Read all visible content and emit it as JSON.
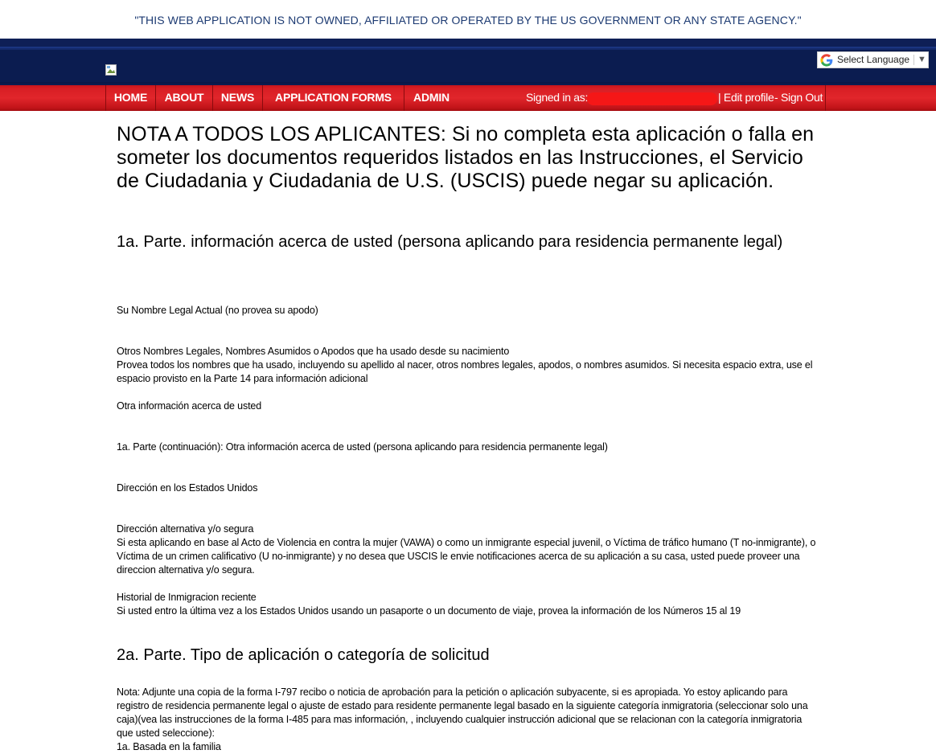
{
  "disclaimer": "\"THIS WEB APPLICATION IS NOT OWNED, AFFILIATED OR OPERATED BY THE US GOVERNMENT OR ANY STATE AGENCY.\"",
  "translate": {
    "label": "Select Language",
    "arrow": "▼",
    "icon": "google-g-icon"
  },
  "nav": {
    "items": [
      {
        "label": "HOME"
      },
      {
        "label": "ABOUT"
      },
      {
        "label": "NEWS"
      },
      {
        "label": "APPLICATION FORMS"
      },
      {
        "label": "ADMIN"
      }
    ],
    "signed_in_label": "Signed in as:",
    "edit_profile": "| Edit profile",
    "separator": "-",
    "sign_out": "Sign Out"
  },
  "colors": {
    "header_blue": "#0e1f56",
    "nav_red": "#d81e24",
    "disclaimer_text": "#1c3a72"
  },
  "main": {
    "notice": "NOTA A TODOS LOS APLICANTES: Si no completa esta aplicación o falla en someter los documentos requeridos listados en las Instrucciones, el Servicio de Ciudadania y Ciudadania de U.S. (USCIS) puede negar su aplicación.",
    "part1_title": "1a. Parte. información acerca de usted (persona aplicando para residencia permanente legal)",
    "legal_name": "Su Nombre Legal Actual (no provea su apodo)",
    "other_names_title": "Otros Nombres Legales, Nombres Asumidos o Apodos que ha usado desde su nacimiento",
    "other_names_desc": "Provea todos los nombres que ha usado, incluyendo su apellido al nacer, otros nombres legales, apodos, o nombres asumidos. Si necesita espacio extra, use el espacio provisto en la Parte 14 para información adicional",
    "other_info": "Otra información acerca de usted",
    "part1_cont": "1a. Parte (continuación): Otra información acerca de usted (persona aplicando para residencia permanente legal)",
    "us_address": "Dirección en los Estados Unidos",
    "alt_address_title": "Dirección alternativa y/o segura",
    "alt_address_desc": "Si esta aplicando en base al Acto de Violencia en contra la mujer (VAWA) o como un inmigrante especial juvenil, o Víctima de tráfico humano (T no-inmigrante), o Víctima de un crimen calificativo (U no-inmigrante) y no desea que USCIS le envie notificaciones acerca de su aplicación a su casa, usted puede proveer una direccion alternativa y/o segura.",
    "immigration_title": "Historial de Inmigracion reciente",
    "immigration_desc": "Si usted entro la última vez a los Estados Unidos usando un pasaporte o un documento de viaje, provea la información de los Números 15 al 19",
    "part2_title": "2a. Parte. Tipo de aplicación o categoría de solicitud",
    "part2_note": "Nota: Adjunte una copia de la forma I-797 recibo o noticia de aprobación para la petición o aplicación subyacente, si es apropiada. Yo estoy aplicando para registro de residencia permanente legal o ajuste de estado para residente permanente legal basado en la siguiente categoría inmigratoria (seleccionar solo una caja)(vea las instrucciones de la forma I-485 para mas información, , incluyendo cualquier instrucción adicional que se relacionan con la categoría inmigratoria que usted seleccione):",
    "family_based": "1a. Basada en la familia"
  }
}
